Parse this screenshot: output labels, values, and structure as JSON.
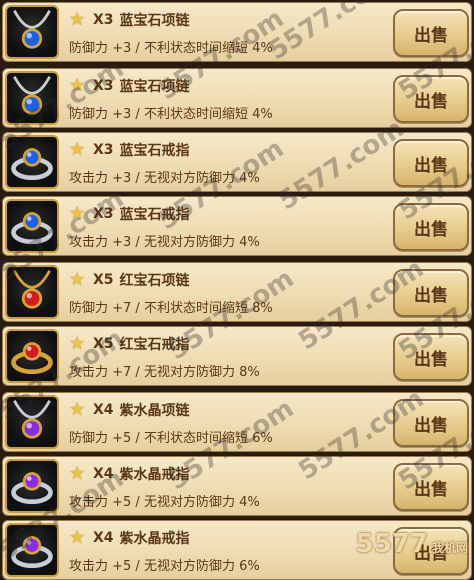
{
  "items": [
    {
      "gem": "sapphire",
      "type": "necklace",
      "qty": "X3",
      "name": "蓝宝石项链",
      "desc": "防御力 +3 / 不利状态时间缩短 4%",
      "sell": "出售"
    },
    {
      "gem": "sapphire",
      "type": "necklace",
      "qty": "X3",
      "name": "蓝宝石项链",
      "desc": "防御力 +3 / 不利状态时间缩短 4%",
      "sell": "出售"
    },
    {
      "gem": "sapphire",
      "type": "ring",
      "qty": "X3",
      "name": "蓝宝石戒指",
      "desc": "攻击力 +3 / 无视对方防御力 4%",
      "sell": "出售"
    },
    {
      "gem": "sapphire",
      "type": "ring",
      "qty": "X3",
      "name": "蓝宝石戒指",
      "desc": "攻击力 +3 / 无视对方防御力 4%",
      "sell": "出售"
    },
    {
      "gem": "ruby",
      "type": "necklace",
      "qty": "X5",
      "name": "红宝石项链",
      "desc": "防御力 +7 / 不利状态时间缩短 8%",
      "sell": "出售"
    },
    {
      "gem": "ruby",
      "type": "ring",
      "qty": "X5",
      "name": "红宝石戒指",
      "desc": "攻击力 +7 / 无视对方防御力 8%",
      "sell": "出售"
    },
    {
      "gem": "amethyst",
      "type": "necklace",
      "qty": "X4",
      "name": "紫水晶项链",
      "desc": "防御力 +5 / 不利状态时间缩短 6%",
      "sell": "出售"
    },
    {
      "gem": "amethyst",
      "type": "ring",
      "qty": "X4",
      "name": "紫水晶戒指",
      "desc": "攻击力 +5 / 无视对方防御力 4%",
      "sell": "出售"
    },
    {
      "gem": "amethyst",
      "type": "ring",
      "qty": "X4",
      "name": "紫水晶戒指",
      "desc": "攻击力 +5 / 无视对方防御力 6%",
      "sell": "出售"
    }
  ],
  "colors": {
    "sapphire": "#1f5fe0",
    "ruby": "#d01c1c",
    "amethyst": "#8a2ce0",
    "gold": "#d6a33a",
    "silver": "#c9ced6"
  },
  "watermark": "5577.com",
  "logo": {
    "brand": "5577",
    "site": "我机网"
  }
}
